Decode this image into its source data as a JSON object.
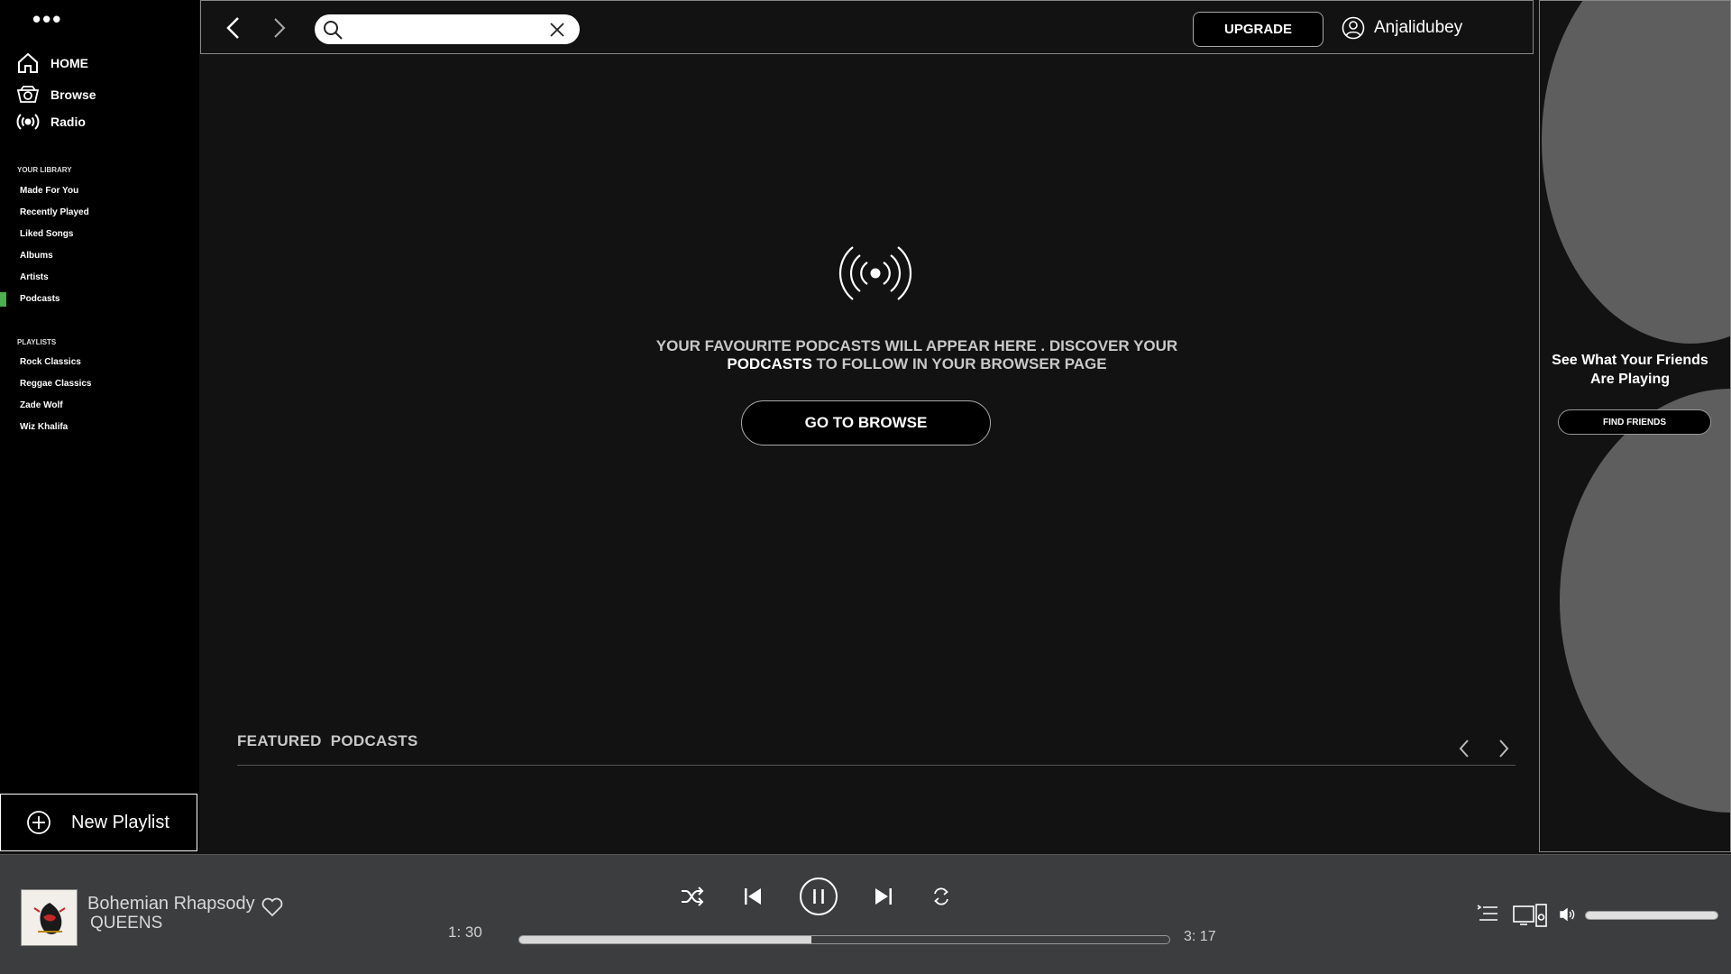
{
  "sidebar": {
    "nav": [
      {
        "label": "HOME",
        "icon": "home-icon"
      },
      {
        "label": "Browse",
        "icon": "browse-icon"
      },
      {
        "label": "Radio",
        "icon": "radio-icon"
      }
    ],
    "library_title": "YOUR LIBRARY",
    "library": [
      "Made For You",
      "Recently Played",
      "Liked Songs",
      "Albums",
      "Artists",
      "Podcasts"
    ],
    "active_library_item": "Podcasts",
    "playlists_title": "PLAYLISTS",
    "playlists": [
      "Rock Classics",
      "Reggae Classics",
      "Zade Wolf",
      "Wiz Khalifa"
    ],
    "new_playlist_label": "New Playlist"
  },
  "topbar": {
    "search_value": "",
    "upgrade_label": "UPGRADE",
    "username": "Anjalidubey"
  },
  "main": {
    "message_line1": "YOUR FAVOURITE PODCASTS WILL APPEAR HERE . DISCOVER YOUR",
    "message_bold": "PODCASTS",
    "message_line2_rest": " TO FOLLOW IN YOUR BROWSER PAGE",
    "browse_button": "GO TO BROWSE",
    "featured_title": "FEATURED  PODCASTS"
  },
  "right_panel": {
    "title": "See What Your Friends Are Playing",
    "find_friends_label": "FIND FRIENDS"
  },
  "player": {
    "track_title": "Bohemian Rhapsody",
    "artist": "QUEENS",
    "elapsed": "1: 30",
    "duration": "3: 17",
    "progress_fraction": 0.45,
    "volume_fraction": 1.0
  },
  "colors": {
    "accent": "#4caf50",
    "background": "#121212",
    "sidebar": "#000000",
    "player_bar": "#3b3d3e"
  }
}
